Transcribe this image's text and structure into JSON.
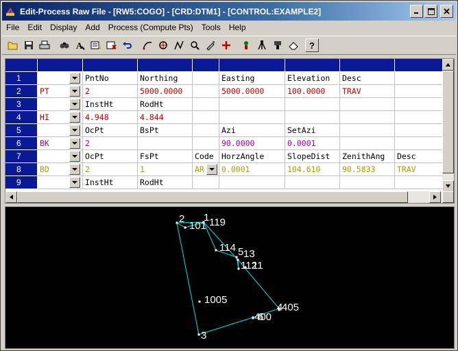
{
  "window": {
    "title": "Edit-Process Raw File - [RW5:COGO] - [CRD:DTM1] - [CONTROL:EXAMPLE2]"
  },
  "menu": [
    "File",
    "Edit",
    "Display",
    "Add",
    "Process (Compute Pts)",
    "Tools",
    "Help"
  ],
  "toolbar": {
    "icons": [
      "open-icon",
      "save-icon",
      "print-icon",
      "find-icon",
      "find-replace-icon",
      "insert-record-icon",
      "delete-record-icon",
      "undo-icon",
      "curve-icon",
      "zoom-icon",
      "traverse-icon",
      "compute-icon",
      "settings-icon",
      "add-point-icon",
      "transform-icon",
      "tripod-icon",
      "instrument-icon",
      "erase-icon",
      "help-icon"
    ]
  },
  "colors": {
    "pt": "#c00000",
    "hi": "#c00000",
    "bk": "#a000a0",
    "bd": "#a0a000",
    "header": "#0a1a96",
    "plot_line": "#00e0e0"
  },
  "grid": {
    "rows": [
      {
        "num": "1",
        "type": "",
        "cells": [
          "PntNo",
          "Northing",
          "",
          "Easting",
          "Elevation",
          "Desc",
          ""
        ]
      },
      {
        "num": "2",
        "type": "PT",
        "cells": [
          "2",
          "5000.0000",
          "",
          "5000.0000",
          "100.0000",
          "TRAV",
          ""
        ]
      },
      {
        "num": "3",
        "type": "",
        "cells": [
          "InstHt",
          "RodHt",
          "",
          "",
          "",
          "",
          ""
        ]
      },
      {
        "num": "4",
        "type": "HI",
        "cells": [
          "4.948",
          "4.844",
          "",
          "",
          "",
          "",
          ""
        ]
      },
      {
        "num": "5",
        "type": "",
        "cells": [
          "OcPt",
          "BsPt",
          "",
          "Azi",
          "SetAzi",
          "",
          ""
        ]
      },
      {
        "num": "6",
        "type": "BK",
        "cells": [
          "2",
          "",
          "",
          "90.0000",
          "0.0001",
          "",
          ""
        ]
      },
      {
        "num": "7",
        "type": "",
        "cells": [
          "OcPt",
          "FsPt",
          "Code",
          "HorzAngle",
          "SlopeDist",
          "ZenithAng",
          "Desc"
        ]
      },
      {
        "num": "8",
        "type": "BD",
        "cells": [
          "2",
          "1",
          "AR",
          "0.0001",
          "104.610",
          "90.5833",
          "TRAV"
        ]
      },
      {
        "num": "9",
        "type": "",
        "cells": [
          "InstHt",
          "RodHt",
          "",
          "",
          "",
          "",
          ""
        ]
      }
    ]
  },
  "plot": {
    "point_labels": [
      "2",
      "101",
      "119",
      "1",
      "114",
      "5",
      "13",
      "112",
      "11",
      "1005",
      "405",
      "4",
      "400",
      "6",
      "3"
    ]
  }
}
